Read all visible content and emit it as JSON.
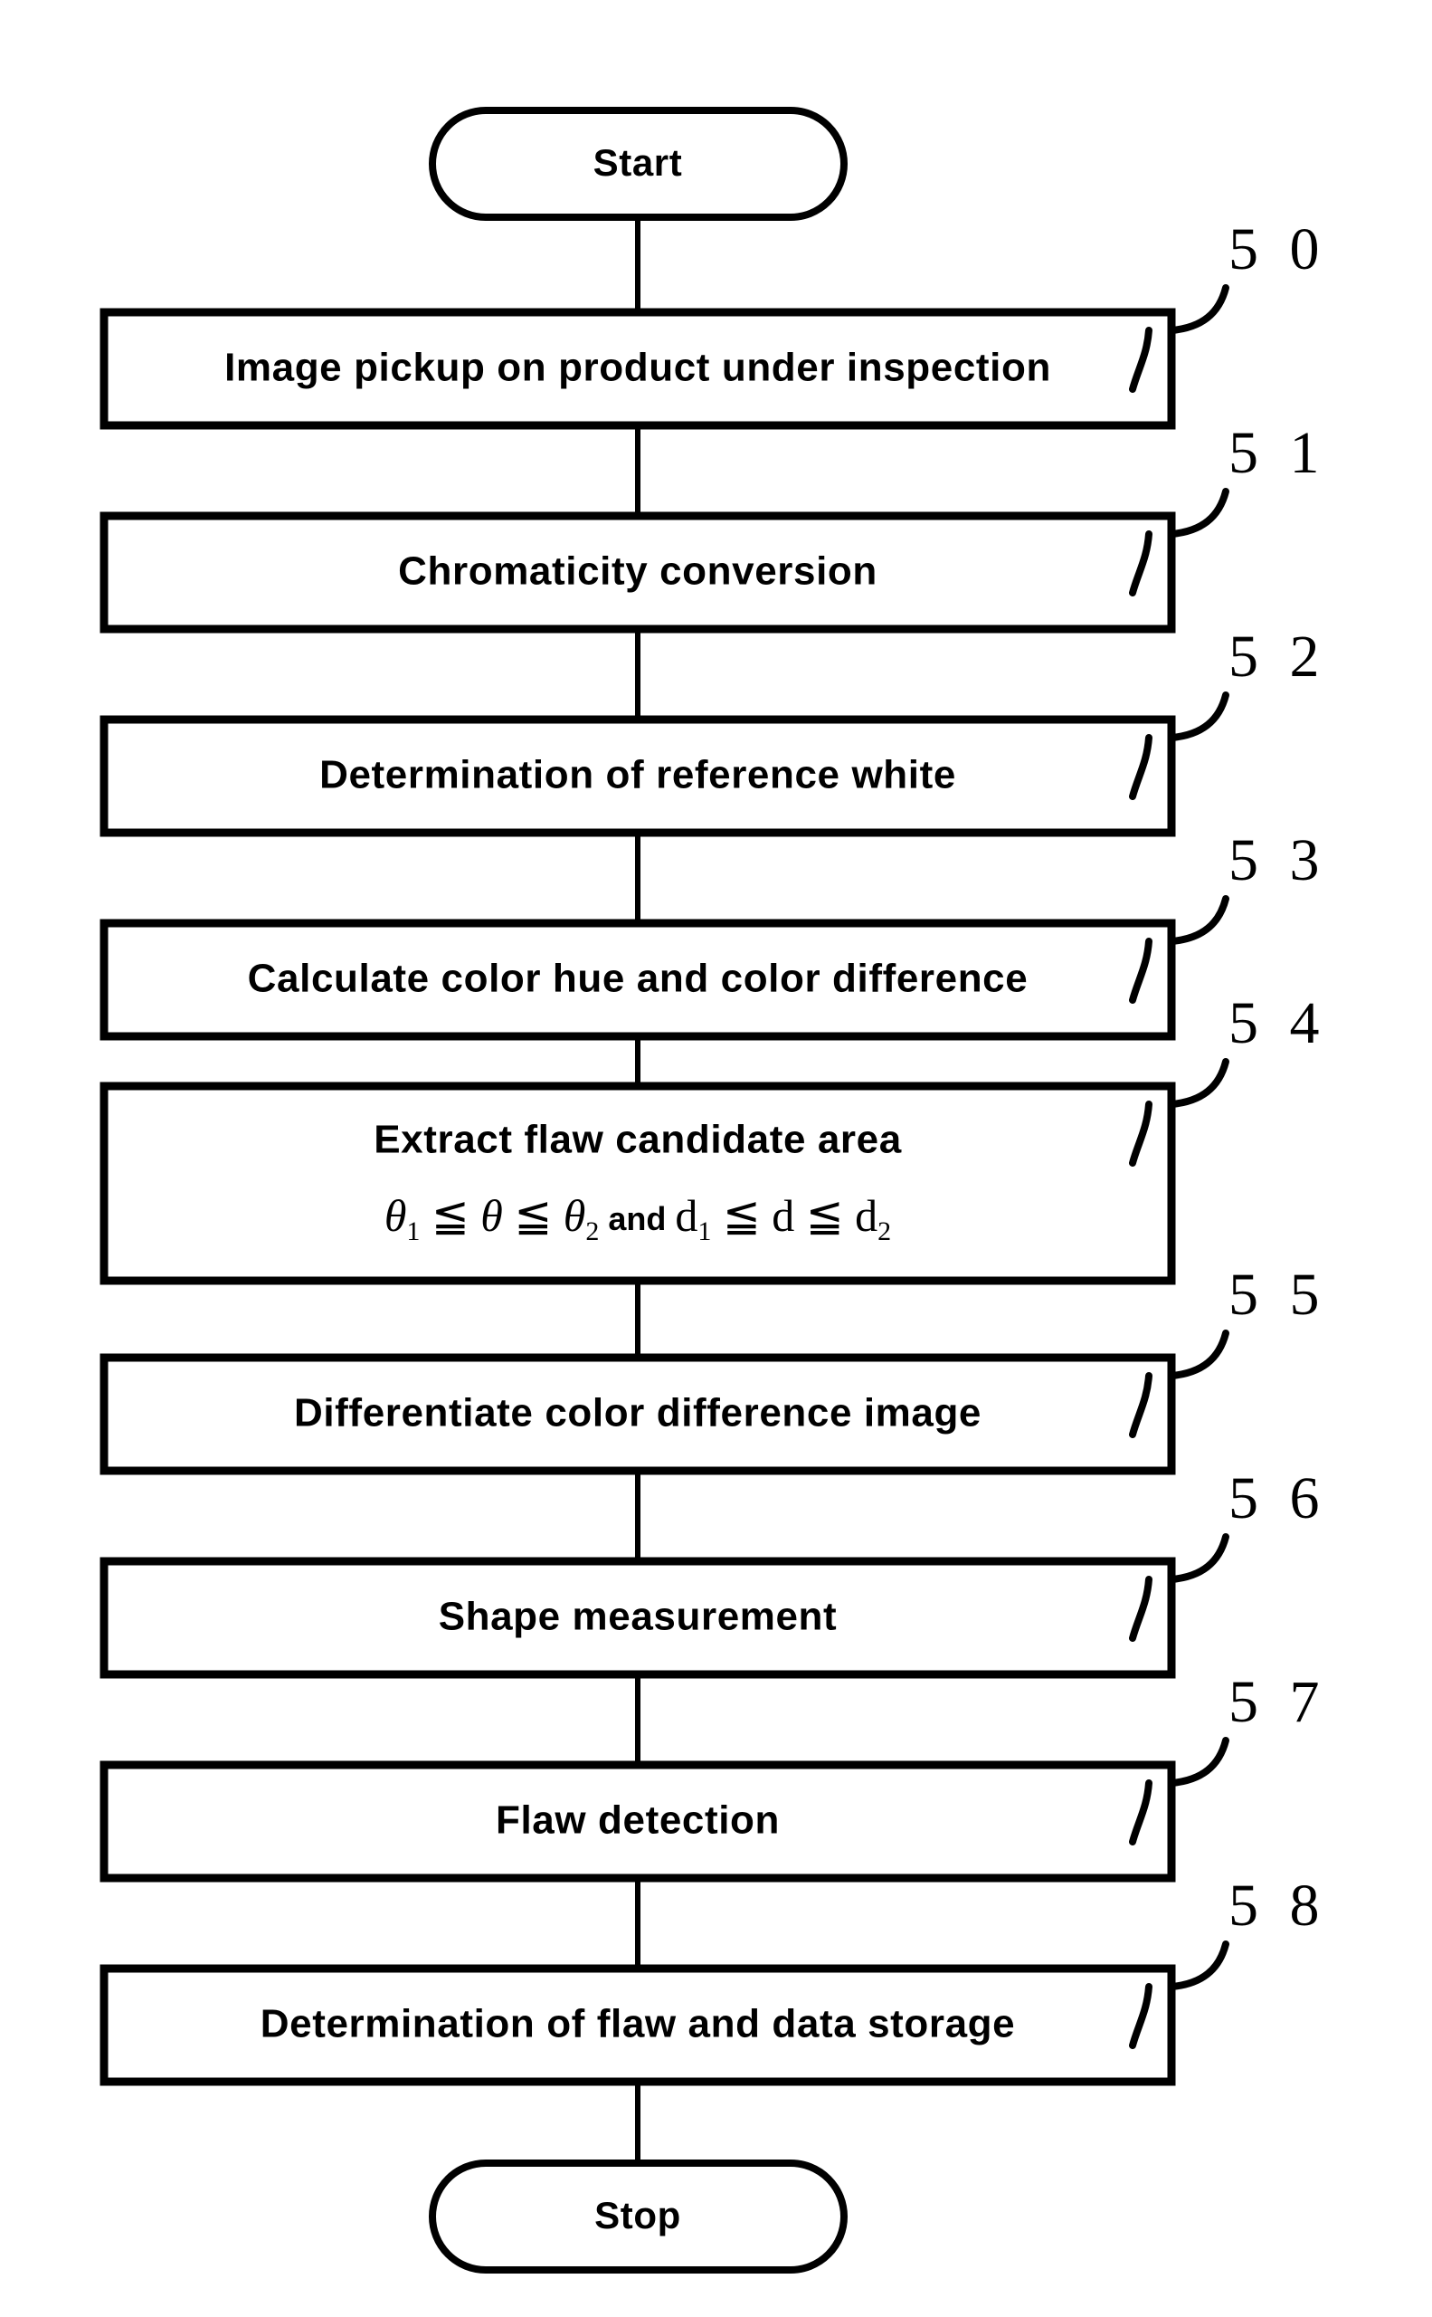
{
  "diagram": {
    "type": "flowchart",
    "orientation": "vertical",
    "start_label": "Start",
    "stop_label": "Stop",
    "steps": [
      {
        "ref": "5 0",
        "label": "Image pickup on product under inspection"
      },
      {
        "ref": "5 1",
        "label": "Chromaticity conversion"
      },
      {
        "ref": "5 2",
        "label": "Determination of reference white"
      },
      {
        "ref": "5 3",
        "label": "Calculate color hue and color difference"
      },
      {
        "ref": "5 4",
        "label": "Extract flaw candidate area",
        "formula": "θ₁ ≦ θ ≦ θ₂ and d₁ ≦ d ≦ d₂"
      },
      {
        "ref": "5 5",
        "label": "Differentiate color difference image"
      },
      {
        "ref": "5 6",
        "label": "Shape measurement"
      },
      {
        "ref": "5 7",
        "label": "Flaw detection"
      },
      {
        "ref": "5 8",
        "label": "Determination of flaw and data storage"
      }
    ],
    "formula_parts": {
      "theta": "θ",
      "sub1": "1",
      "sub2": "2",
      "le": "≦",
      "and": "and",
      "d": "d"
    },
    "colors": {
      "stroke": "#000000",
      "fill": "#ffffff",
      "text": "#000000"
    }
  }
}
